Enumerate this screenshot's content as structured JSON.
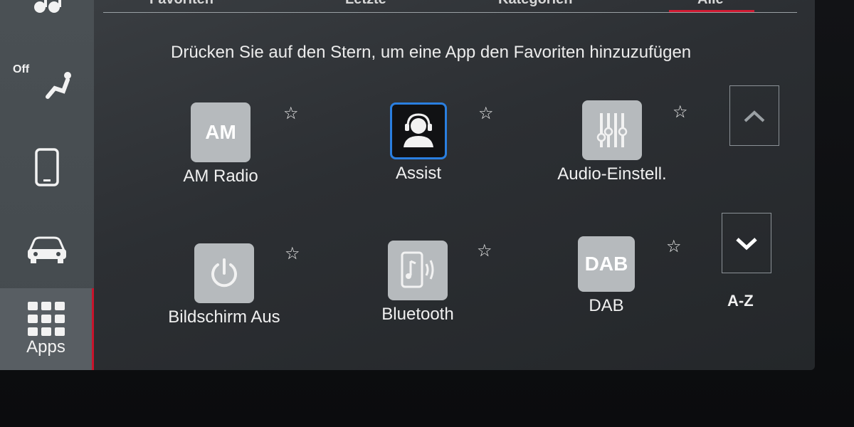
{
  "tabs": [
    {
      "label": "Favoriten"
    },
    {
      "label": "Letzte"
    },
    {
      "label": "Kategorien"
    },
    {
      "label": "Alle",
      "active": true
    }
  ],
  "hint": "Drücken Sie auf den Stern, um eine App den Favoriten hinzuzufügen",
  "sidebar": {
    "items": [
      {
        "icon": "music-icon"
      },
      {
        "icon": "seat-ventilation-icon",
        "label": "Off"
      },
      {
        "icon": "phone-icon"
      },
      {
        "icon": "car-icon"
      },
      {
        "icon": "apps-grid-icon",
        "label": "Apps",
        "active": true
      }
    ]
  },
  "apps": [
    {
      "label": "AM Radio",
      "icon_text": "AM",
      "icon": "am-radio-icon"
    },
    {
      "label": "Assist",
      "icon": "assist-headset-icon"
    },
    {
      "label": "Audio-Einstell.",
      "icon": "audio-sliders-icon"
    },
    {
      "label": "Bildschirm Aus",
      "icon": "power-icon"
    },
    {
      "label": "Bluetooth",
      "icon": "bluetooth-audio-icon"
    },
    {
      "label": "DAB",
      "icon_text": "DAB",
      "icon": "dab-icon"
    }
  ],
  "scroll": {
    "up_icon": "chevron-up-icon",
    "down_icon": "chevron-down-icon"
  },
  "sort_label": "A-Z",
  "colors": {
    "accent": "#d01a32",
    "assist_border": "#2a7fe0",
    "icon_bg": "#b6babd"
  }
}
